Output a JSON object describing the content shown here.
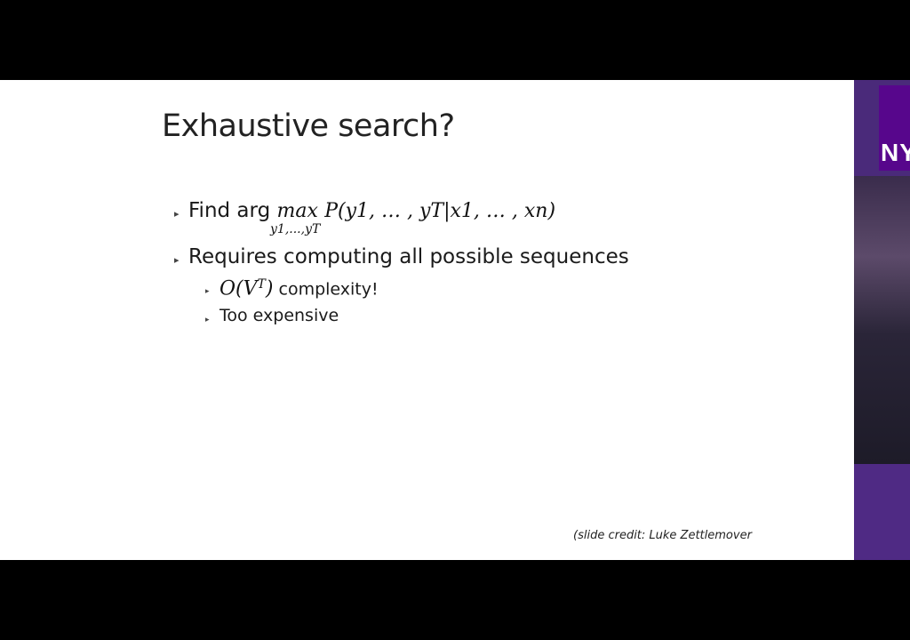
{
  "slide": {
    "title": "Exhaustive search?",
    "bullets": [
      {
        "prefix": "Find arg",
        "math_main": "max",
        "math_under": "y1,...,yT",
        "math_expr": "P(y1, … , yT|x1, … , xn)"
      },
      {
        "text": "Requires computing all possible sequences",
        "sub_items": [
          {
            "math": "O(V",
            "superscript": "T",
            "math_close": ")",
            "text": "complexity!"
          },
          {
            "text": "Too expensive"
          }
        ]
      }
    ],
    "credit": "(slide credit: Luke Zettlemover"
  },
  "sidepanel": {
    "logo_text": "NY"
  },
  "colors": {
    "letterbox": "#000000",
    "slide_bg": "#ffffff",
    "nyu_purple": "#57068c"
  }
}
